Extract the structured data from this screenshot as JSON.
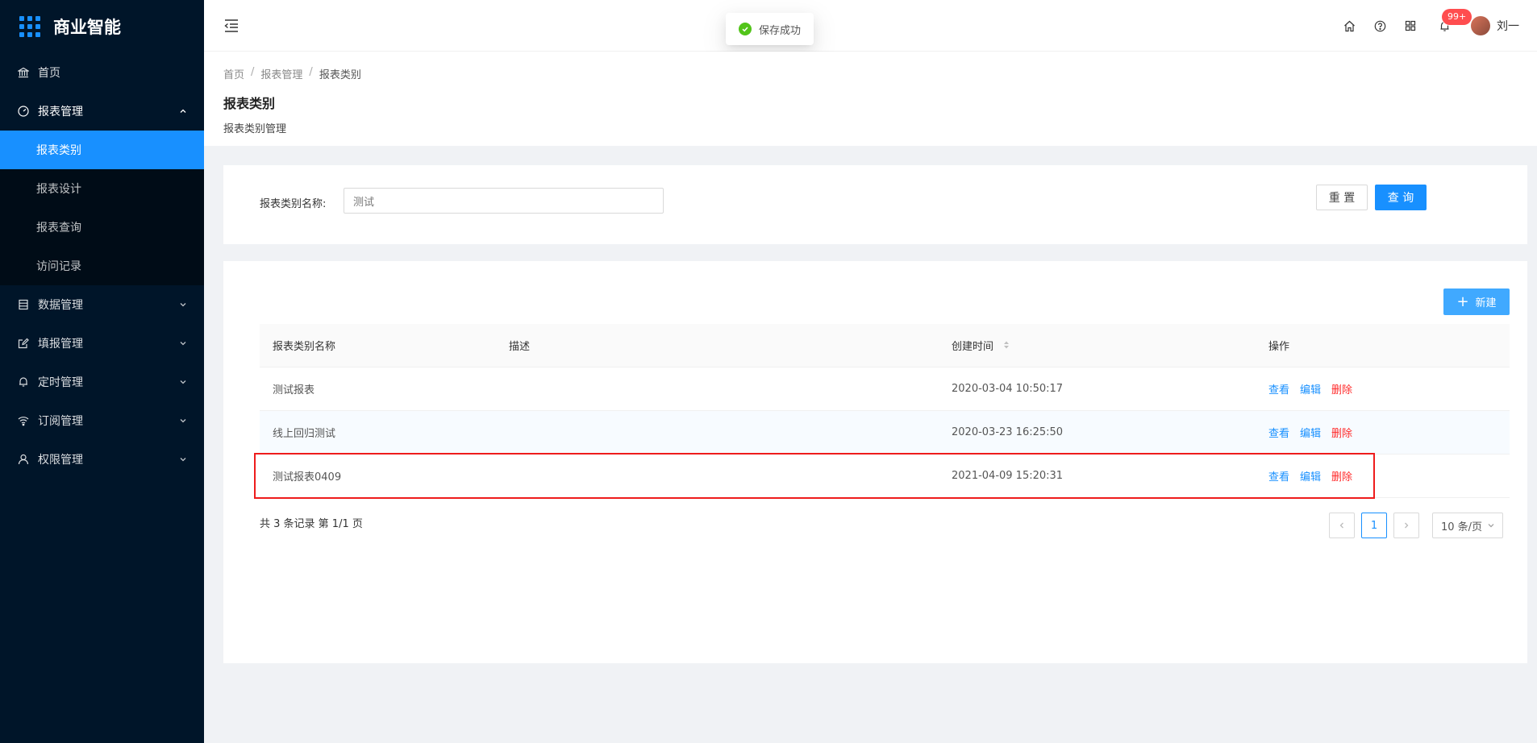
{
  "app": {
    "title": "商业智能",
    "brand_color": "#1890ff"
  },
  "sidebar": {
    "items": [
      {
        "label": "首页",
        "icon": "bank-icon"
      },
      {
        "label": "报表管理",
        "icon": "dashboard-icon",
        "expanded": true,
        "children": [
          {
            "label": "报表类别",
            "active": true
          },
          {
            "label": "报表设计"
          },
          {
            "label": "报表查询"
          },
          {
            "label": "访问记录"
          }
        ]
      },
      {
        "label": "数据管理",
        "icon": "database-icon"
      },
      {
        "label": "填报管理",
        "icon": "form-icon"
      },
      {
        "label": "定时管理",
        "icon": "bell-icon"
      },
      {
        "label": "订阅管理",
        "icon": "wifi-icon"
      },
      {
        "label": "权限管理",
        "icon": "user-icon"
      }
    ]
  },
  "header": {
    "toast": "保存成功",
    "notification_count": "99+",
    "username": "刘一"
  },
  "page": {
    "breadcrumb": [
      "首页",
      "报表管理",
      "报表类别"
    ],
    "title": "报表类别",
    "description": "报表类别管理"
  },
  "search": {
    "label": "报表类别名称:",
    "value": "测试",
    "reset_label": "重 置",
    "query_label": "查 询"
  },
  "table": {
    "new_label": "新建",
    "columns": [
      "报表类别名称",
      "描述",
      "创建时间",
      "操作"
    ],
    "rows": [
      {
        "name": "测试报表",
        "desc": "",
        "created": "2020-03-04 10:50:17"
      },
      {
        "name": "线上回归测试",
        "desc": "",
        "created": "2020-03-23 16:25:50"
      },
      {
        "name": "测试报表0409",
        "desc": "",
        "created": "2021-04-09 15:20:31"
      }
    ],
    "actions": {
      "view": "查看",
      "edit": "编辑",
      "delete": "删除"
    }
  },
  "pagination": {
    "summary": "共 3 条记录 第 1/1 页",
    "current_page": "1",
    "page_size": "10 条/页"
  }
}
